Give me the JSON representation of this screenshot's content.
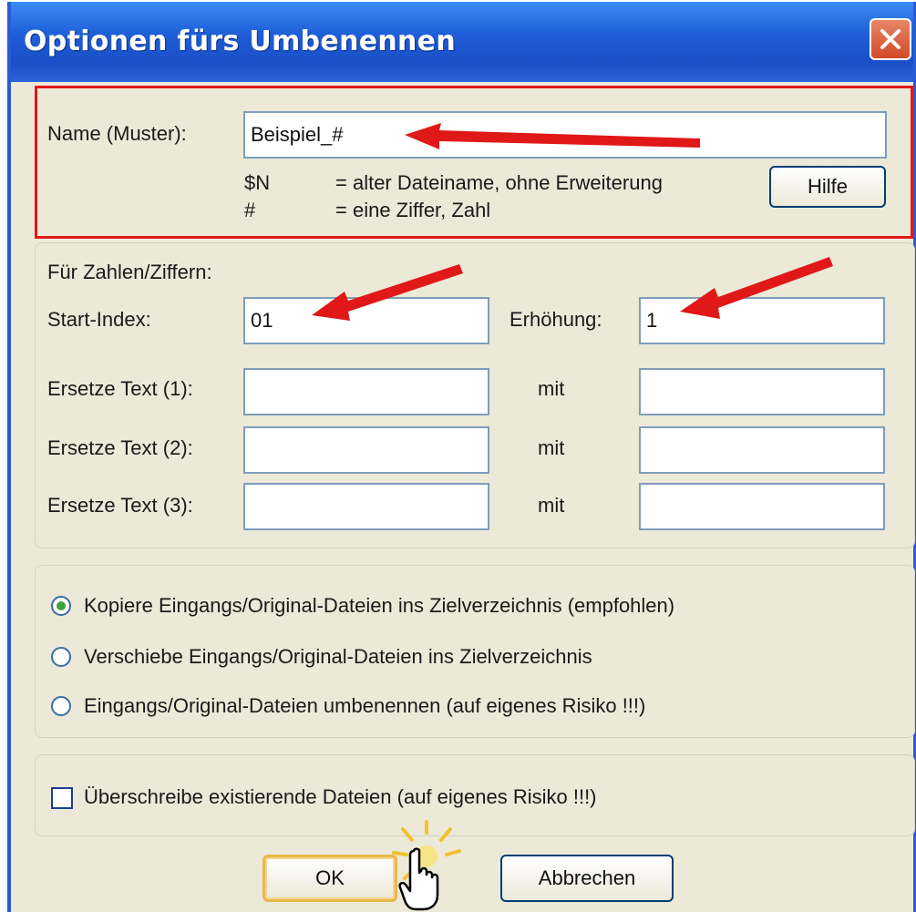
{
  "window": {
    "title": "Optionen fürs Umbenennen"
  },
  "pattern": {
    "label": "Name (Muster):",
    "value": "Beispiel_#",
    "help_rows": [
      {
        "token": "$N",
        "desc": "= alter Dateiname, ohne Erweiterung"
      },
      {
        "token": "#",
        "desc": "= eine Ziffer, Zahl"
      }
    ],
    "help_button": "Hilfe"
  },
  "numbers": {
    "heading": "Für Zahlen/Ziffern:",
    "start_label": "Start-Index:",
    "start_value": "01",
    "increment_label": "Erhöhung:",
    "increment_value": "1"
  },
  "replace": [
    {
      "label": "Ersetze Text (1):",
      "with": "mit",
      "find": "",
      "replace": ""
    },
    {
      "label": "Ersetze Text (2):",
      "with": "mit",
      "find": "",
      "replace": ""
    },
    {
      "label": "Ersetze Text (3):",
      "with": "mit",
      "find": "",
      "replace": ""
    }
  ],
  "mode": {
    "options": [
      {
        "label": "Kopiere Eingangs/Original-Dateien ins Zielverzeichnis (empfohlen)",
        "selected": true
      },
      {
        "label": "Verschiebe Eingangs/Original-Dateien ins Zielverzeichnis",
        "selected": false
      },
      {
        "label": "Eingangs/Original-Dateien umbenennen (auf eigenes Risiko !!!)",
        "selected": false
      }
    ]
  },
  "overwrite": {
    "label": "Überschreibe existierende Dateien (auf eigenes Risiko !!!)",
    "checked": false
  },
  "buttons": {
    "ok": "OK",
    "cancel": "Abbrechen"
  },
  "annotation_color": "#e01818"
}
